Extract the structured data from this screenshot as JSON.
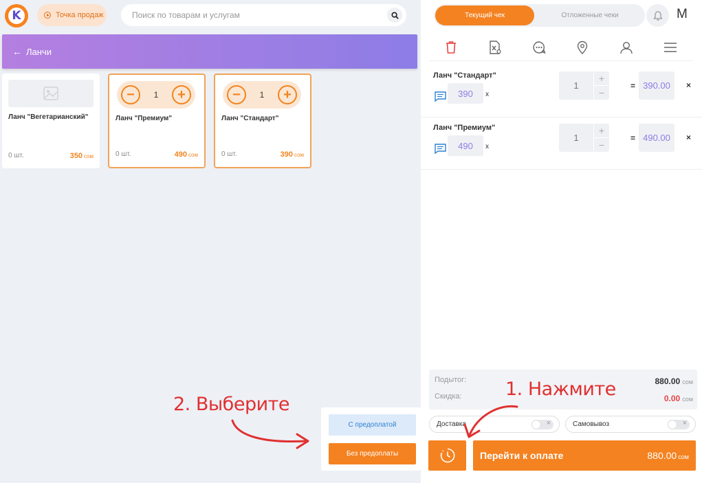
{
  "logo": {
    "letter": "K"
  },
  "header": {
    "pos_label": "Точка продаж",
    "search_placeholder": "Поиск по товарам и услугам"
  },
  "category": {
    "title": "Ланчи"
  },
  "products": [
    {
      "name": "Ланч \"Вегетарианский\"",
      "qty": "0 шт.",
      "price": "350",
      "currency": "сом",
      "stepper_value": null
    },
    {
      "name": "Ланч \"Премиум\"",
      "qty": "0 шт.",
      "price": "490",
      "currency": "сом",
      "stepper_value": "1"
    },
    {
      "name": "Ланч \"Стандарт\"",
      "qty": "0 шт.",
      "price": "390",
      "currency": "сом",
      "stepper_value": "1"
    }
  ],
  "stepper": {
    "minus": "−",
    "plus": "+"
  },
  "popup": {
    "prepaid": "С предоплатой",
    "no_prepaid": "Без предоплаты"
  },
  "receipt_tabs": {
    "current": "Текущий чек",
    "deferred": "Отложенные чеки"
  },
  "user": {
    "initial": "M"
  },
  "cart_items": [
    {
      "name": "Ланч \"Стандарт\"",
      "price": "390",
      "mult": "x",
      "qty": "1",
      "eq": "=",
      "total": "390.00",
      "remove": "×"
    },
    {
      "name": "Ланч \"Премиум\"",
      "price": "490",
      "mult": "x",
      "qty": "1",
      "eq": "=",
      "total": "490.00",
      "remove": "×"
    }
  ],
  "summary": {
    "subtotal_label": "Подытог:",
    "subtotal_value": "880.00",
    "discount_label": "Скидка:",
    "discount_value": "0.00",
    "currency": "сом"
  },
  "toggles": {
    "delivery": "Доставка",
    "pickup": "Самовывоз"
  },
  "checkout": {
    "label": "Перейти к оплате",
    "amount": "880.00",
    "currency": "сом"
  },
  "annotations": {
    "step1": "1. Нажмите",
    "step2": "2. Выберите"
  },
  "colors": {
    "accent": "#f58220",
    "purple": "#8d7de6",
    "annotation": "#e03030"
  }
}
